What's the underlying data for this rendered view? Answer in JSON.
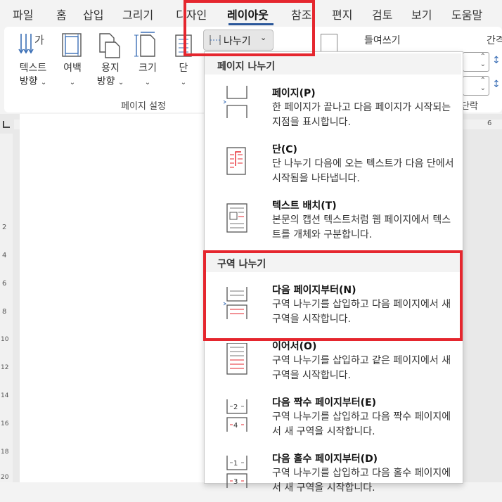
{
  "menu": {
    "tabs": [
      "파일",
      "홈",
      "삽입",
      "그리기",
      "디자인",
      "레이아웃",
      "참조",
      "편지",
      "검토",
      "보기",
      "도움말"
    ],
    "active": "레이아웃"
  },
  "ribbon": {
    "text_direction": [
      "텍스트",
      "방향"
    ],
    "margins": "여백",
    "orientation": [
      "용지",
      "방향"
    ],
    "size": "크기",
    "columns": "단",
    "breaks": "나누기",
    "group_label": "페이지 설정",
    "indent_label": "들여쓰기",
    "spacing_label": "간격",
    "paragraph_label": "단락"
  },
  "ruler": {
    "h_numbers": [
      "4",
      "6"
    ],
    "v_numbers": [
      "2",
      "4",
      "6",
      "8",
      "10",
      "12",
      "14",
      "16",
      "18",
      "20"
    ]
  },
  "dropdown": {
    "page_breaks_heading": "페이지 나누기",
    "section_breaks_heading": "구역 나누기",
    "items": [
      {
        "title": "페이지(P)",
        "desc": "한 페이지가 끝나고 다음 페이지가 시작되는 지점을 표시합니다."
      },
      {
        "title": "단(C)",
        "desc": "단 나누기 다음에 오는 텍스트가 다음 단에서 시작됨을 나타냅니다."
      },
      {
        "title": "텍스트 배치(T)",
        "desc": "본문의 캡션 텍스트처럼 웹 페이지에서 텍스트를 개체와 구분합니다."
      },
      {
        "title": "다음 페이지부터(N)",
        "desc": "구역 나누기를 삽입하고 다음 페이지에서 새 구역을 시작합니다."
      },
      {
        "title": "이어서(O)",
        "desc": "구역 나누기를 삽입하고 같은 페이지에서 새 구역을 시작합니다."
      },
      {
        "title": "다음 짝수 페이지부터(E)",
        "desc": "구역 나누기를 삽입하고 다음 짝수 페이지에서 새 구역을 시작합니다."
      },
      {
        "title": "다음 홀수 페이지부터(D)",
        "desc": "구역 나누기를 삽입하고 다음 홀수 페이지에서 새 구역을 시작합니다."
      }
    ]
  },
  "colors": {
    "highlight": "#e5262e",
    "accent": "#2b579a"
  }
}
